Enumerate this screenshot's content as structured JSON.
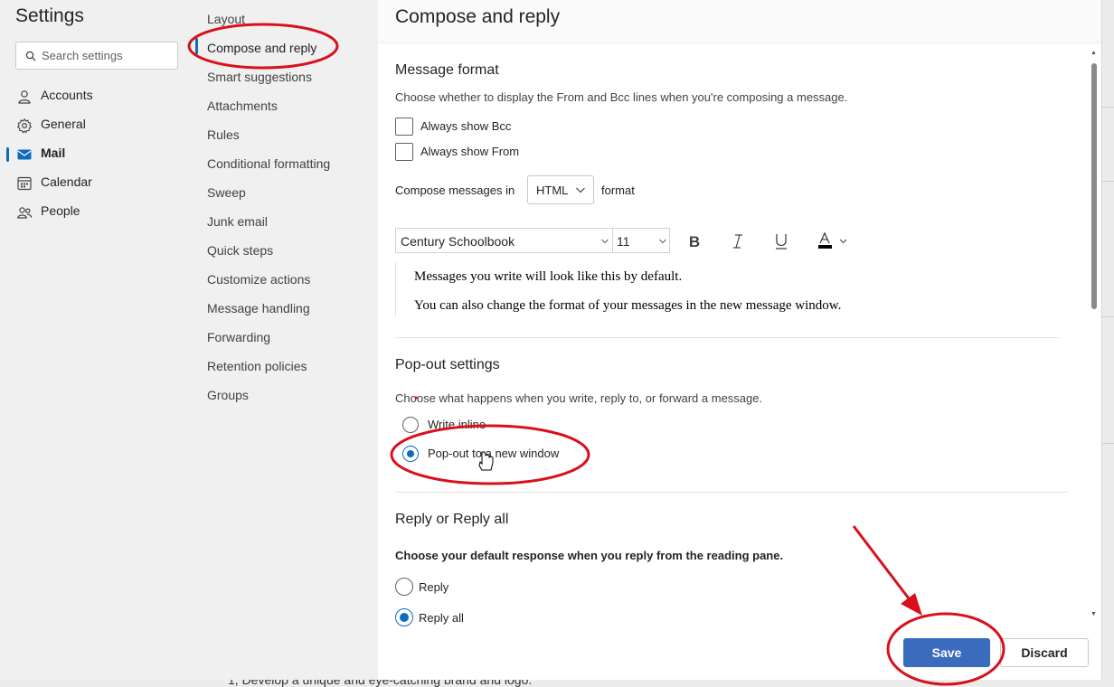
{
  "settings_panel": {
    "title": "Settings",
    "search": {
      "placeholder": "Search settings",
      "icon": "search-icon"
    },
    "nav": [
      {
        "label": "Accounts",
        "icon": "person-icon"
      },
      {
        "label": "General",
        "icon": "gear-icon"
      },
      {
        "label": "Mail",
        "icon": "mail-icon",
        "active": true
      },
      {
        "label": "Calendar",
        "icon": "calendar-icon"
      },
      {
        "label": "People",
        "icon": "people-icon"
      }
    ]
  },
  "mail_subnav": [
    {
      "label": "Layout"
    },
    {
      "label": "Compose and reply",
      "active": true
    },
    {
      "label": "Smart suggestions"
    },
    {
      "label": "Attachments"
    },
    {
      "label": "Rules"
    },
    {
      "label": "Conditional formatting"
    },
    {
      "label": "Sweep"
    },
    {
      "label": "Junk email"
    },
    {
      "label": "Quick steps"
    },
    {
      "label": "Customize actions"
    },
    {
      "label": "Message handling"
    },
    {
      "label": "Forwarding"
    },
    {
      "label": "Retention policies"
    },
    {
      "label": "Groups"
    }
  ],
  "content": {
    "title": "Compose and reply",
    "message_format": {
      "heading": "Message format",
      "description": "Choose whether to display the From and Bcc lines when you're composing a message.",
      "always_show_bcc": {
        "label": "Always show Bcc",
        "checked": false
      },
      "always_show_from": {
        "label": "Always show From",
        "checked": false
      },
      "compose_in_label": "Compose messages in",
      "compose_format": "HTML",
      "compose_format_suffix": "format",
      "font": "Century Schoolbook",
      "font_size": "11",
      "toolbar_icons": [
        "bold-icon",
        "italic-icon",
        "underline-icon",
        "font-color-icon"
      ],
      "preview_line_1": "Messages you write will look like this by default.",
      "preview_line_2": "You can also change the format of your messages in the new message window."
    },
    "popout": {
      "heading": "Pop-out settings",
      "description": "Choose what happens when you write, reply to, or forward a message.",
      "options": [
        {
          "label": "Write inline",
          "selected": false
        },
        {
          "label": "Pop-out to a new window",
          "selected": true
        }
      ]
    },
    "reply": {
      "heading": "Reply or Reply all",
      "description": "Choose your default response when you reply from the reading pane.",
      "options": [
        {
          "label": "Reply",
          "selected": false
        },
        {
          "label": "Reply all",
          "selected": true
        }
      ]
    }
  },
  "footer": {
    "save_label": "Save",
    "discard_label": "Discard"
  },
  "background_text": "1, Develop a unique and eye-catching brand and logo.",
  "colors": {
    "accent": "#0f6cbd",
    "save_button": "#3b6bbd",
    "annotation": "#d9101b"
  }
}
